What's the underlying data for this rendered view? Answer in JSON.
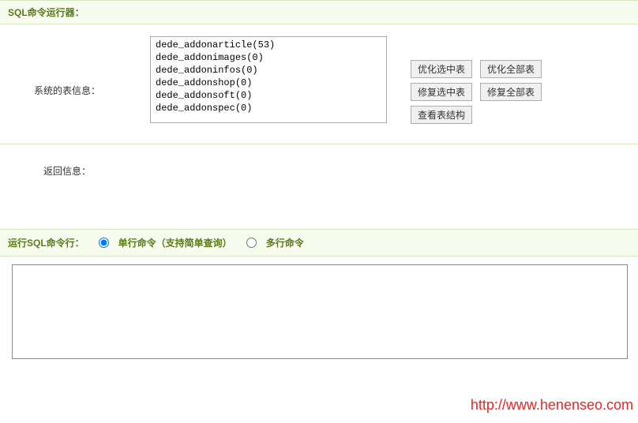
{
  "header": {
    "title": "SQL命令运行器："
  },
  "tableInfo": {
    "label": "系统的表信息：",
    "items": [
      "dede_addonarticle(53)",
      "dede_addonimages(0)",
      "dede_addoninfos(0)",
      "dede_addonshop(0)",
      "dede_addonsoft(0)",
      "dede_addonspec(0)"
    ]
  },
  "buttons": {
    "optimize_selected": "优化选中表",
    "optimize_all": "优化全部表",
    "repair_selected": "修复选中表",
    "repair_all": "修复全部表",
    "view_structure": "查看表结构"
  },
  "returnInfo": {
    "label": "返回信息："
  },
  "commandRow": {
    "label": "运行SQL命令行：",
    "single": "单行命令（支持简单查询）",
    "multi": "多行命令"
  },
  "watermark": "http://www.henenseo.com"
}
